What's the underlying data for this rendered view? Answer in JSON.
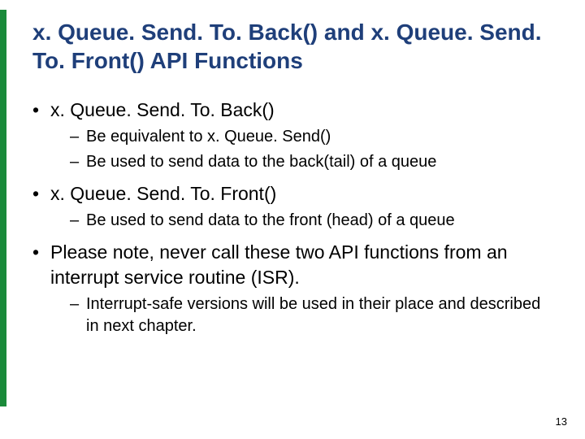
{
  "title": "x. Queue. Send. To. Back() and x. Queue. Send. To. Front() API Functions",
  "bullets": [
    {
      "text": "x. Queue. Send. To. Back()",
      "sub": [
        "Be equivalent to x. Queue. Send()",
        "Be used to send data to the back(tail) of a queue"
      ]
    },
    {
      "text": "x. Queue. Send. To. Front()",
      "sub": [
        "Be used to send data to the front (head) of a queue"
      ]
    },
    {
      "text": "Please note, never call these two API functions from an interrupt service routine (ISR).",
      "sub": [
        "Interrupt-safe versions will be used in their place and described in next chapter."
      ]
    }
  ],
  "page_number": "13",
  "colors": {
    "accent": "#1a8a3a",
    "title": "#1f3f7a"
  }
}
